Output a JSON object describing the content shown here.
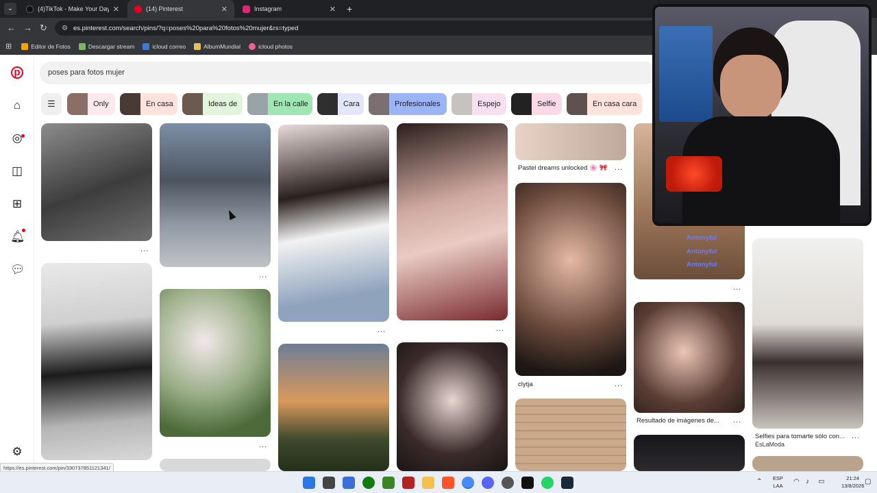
{
  "browser": {
    "tabs": [
      {
        "title": "(4)TikTok - Make Your Day",
        "color": "#111111"
      },
      {
        "title": "(14) Pinterest",
        "color": "#e60023"
      },
      {
        "title": "Instagram",
        "color": "#d62976"
      }
    ],
    "url": "es.pinterest.com/search/pins/?q=poses%20para%20fotos%20mujer&rs=typed",
    "bookmarks": [
      {
        "label": "Editor de Fotos",
        "color": "#f4a300"
      },
      {
        "label": "Descargar stream",
        "color": "#7bb661"
      },
      {
        "label": "icloud correo",
        "color": "#3a7bd5"
      },
      {
        "label": "AlbumMundial",
        "color": "#e0c060"
      },
      {
        "label": "icloud photos",
        "color": "#f06292"
      }
    ]
  },
  "search": {
    "query": "poses para fotos mujer"
  },
  "filters": [
    {
      "label": "Only",
      "color": "#fde8ee",
      "thumb": "#8a6f66"
    },
    {
      "label": "En casa",
      "color": "#fde3dc",
      "thumb": "#4a3a35"
    },
    {
      "label": "Ideas de",
      "color": "#e2f4dc",
      "thumb": "#6a5a4f"
    },
    {
      "label": "En la calle",
      "color": "#9ee6b2",
      "thumb": "#9aa3a8"
    },
    {
      "label": "Cara",
      "color": "#e4e6fb",
      "thumb": "#2f2f2f"
    },
    {
      "label": "Profesionales",
      "color": "#9bb4f6",
      "thumb": "#7b6f72"
    },
    {
      "label": "Espejo",
      "color": "#f8e0f0",
      "thumb": "#c7c2bf"
    },
    {
      "label": "Selfie",
      "color": "#fbd9e7",
      "thumb": "#222222"
    },
    {
      "label": "En casa cara",
      "color": "#fde3dc",
      "thumb": "#5e5250"
    }
  ],
  "pins": {
    "captions": {
      "pastel": "Pastel dreams unlocked 🌸 🎀",
      "clytja": "clytja",
      "resultado": "Resultado de imágenes de...",
      "selfies": "Selfies para tomarte sólo con...",
      "selfies_source": "EsLaModa"
    },
    "overlay_names": [
      "Antonyful",
      "Antonyful",
      "Antonyful"
    ],
    "more_label": "..."
  },
  "status_url": "https://es.pinterest.com/pin/330737851121341/",
  "taskbar": {
    "lang_top": "ESP",
    "lang_bottom": "LAA",
    "time": "21:24",
    "date": "13/8/2026"
  }
}
